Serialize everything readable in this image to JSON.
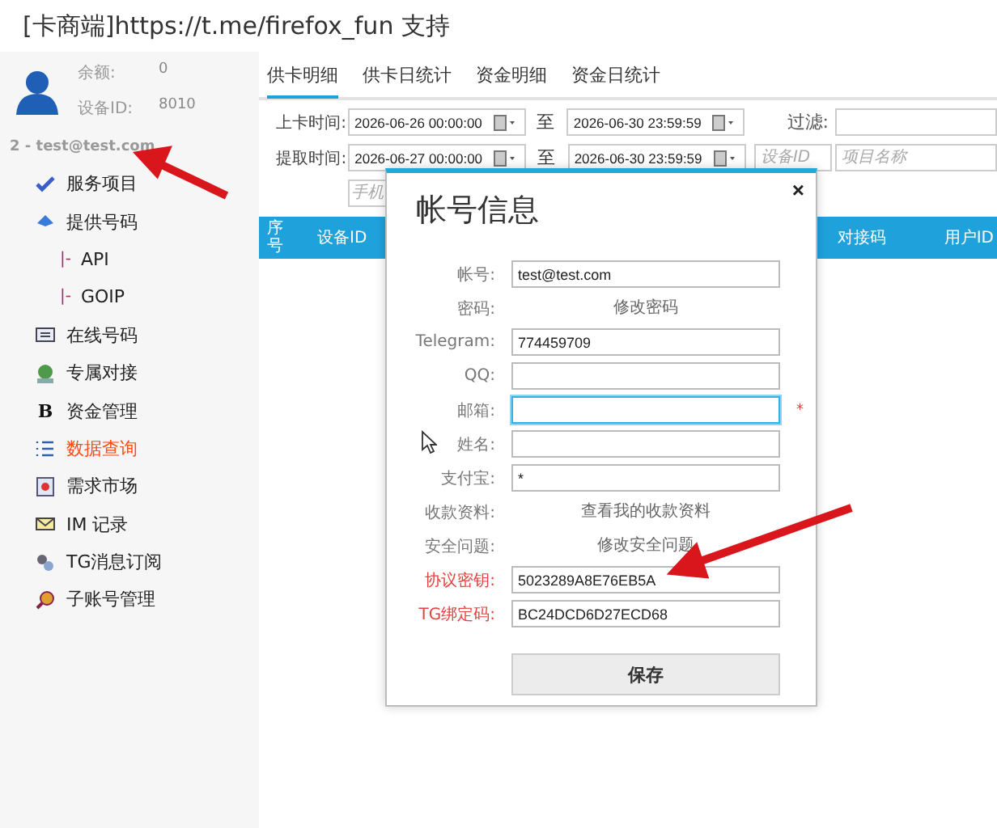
{
  "window": {
    "title": "[卡商端]https://t.me/firefox_fun 支持"
  },
  "profile": {
    "balance_label": "余额:",
    "balance": "0",
    "device_label": "设备ID:",
    "device_id": "8010",
    "account": "2 - test@test.com"
  },
  "menu": [
    {
      "label": "服务项目",
      "selected": false
    },
    {
      "label": "提供号码",
      "selected": false,
      "children": [
        {
          "marker": "|-",
          "label": "API",
          "selected": false
        },
        {
          "marker": "|-",
          "label": "GOIP",
          "selected": false
        }
      ]
    },
    {
      "label": "在线号码",
      "selected": false
    },
    {
      "label": "专属对接",
      "selected": false
    },
    {
      "label": "资金管理",
      "selected": false,
      "glyph": "B"
    },
    {
      "label": "数据查询",
      "selected": true
    },
    {
      "label": "需求市场",
      "selected": false
    },
    {
      "label": "IM 记录",
      "selected": false
    },
    {
      "label": "TG消息订阅",
      "selected": false
    },
    {
      "label": "子账号管理",
      "selected": false
    }
  ],
  "tabs": [
    {
      "label": "供卡明细",
      "selected": true
    },
    {
      "label": "供卡日统计",
      "selected": false
    },
    {
      "label": "资金明细",
      "selected": false
    },
    {
      "label": "资金日统计",
      "selected": false
    }
  ],
  "filters": {
    "upload_label": "上卡时间:",
    "upload_from": "2026-06-26 00:00:00",
    "upload_to_label": "至",
    "upload_to": "2026-06-30 23:59:59",
    "filter_label": "过滤:",
    "fetch_label": "提取时间:",
    "fetch_from": "2026-06-27 00:00:00",
    "fetch_to_label": "至",
    "fetch_to": "2026-06-30 23:59:59",
    "device_placeholder": "设备ID",
    "project_placeholder": "项目名称",
    "phone_placeholder": "手机"
  },
  "table": {
    "columns_left": [
      "序号",
      "设备ID"
    ],
    "columns_right": [
      "对接码",
      "用户ID"
    ]
  },
  "dialog": {
    "title": "帐号信息",
    "close": "×",
    "rows": [
      {
        "kind": "input",
        "label": "帐号:",
        "value": "test@test.com",
        "highlighted": false,
        "focused": false
      },
      {
        "kind": "link",
        "label": "密码:",
        "value": "修改密码",
        "highlighted": false
      },
      {
        "kind": "input",
        "label": "Telegram:",
        "value": "774459709",
        "highlighted": false,
        "focused": false
      },
      {
        "kind": "input",
        "label": "QQ:",
        "highlighted": false,
        "focused": false
      },
      {
        "kind": "input",
        "label": "邮箱:",
        "highlighted": false,
        "focused": true,
        "note": "*"
      },
      {
        "kind": "input",
        "label": "姓名:",
        "highlighted": false,
        "focused": false
      },
      {
        "kind": "input",
        "label": "支付宝:",
        "value": "*",
        "highlighted": false,
        "focused": false
      },
      {
        "kind": "link",
        "label": "收款资料:",
        "value": "查看我的收款资料",
        "highlighted": false
      },
      {
        "kind": "link",
        "label": "安全问题:",
        "value": "修改安全问题",
        "highlighted": false
      },
      {
        "kind": "input",
        "label": "协议密钥:",
        "value": "5023289A8E76EB5A",
        "highlighted": true,
        "focused": false
      },
      {
        "kind": "input",
        "label": "TG绑定码:",
        "value": "BC24DCD6D27ECD68",
        "highlighted": true,
        "focused": false
      }
    ],
    "save": "保存"
  }
}
